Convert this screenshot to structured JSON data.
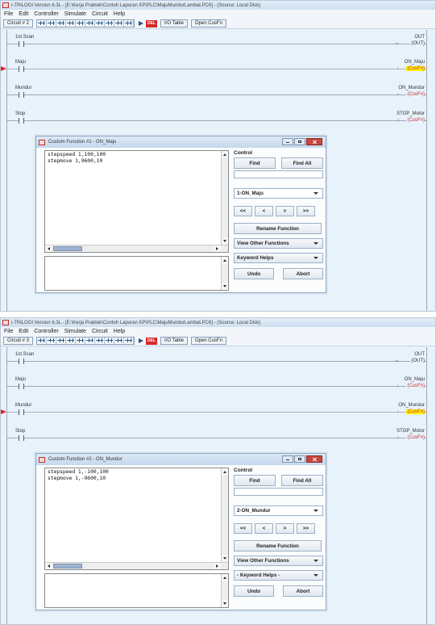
{
  "shots": [
    {
      "title": "i-TRiLOGI Version 6.3L - [E:\\Kerja Praktek\\Contoh Laporan KP\\PLC\\MajuMundurLambat.PC6] - (Source: Local Disk)",
      "menu": [
        "File",
        "Edit",
        "Controller",
        "Simulate",
        "Circuit",
        "Help"
      ],
      "circuit_label": "Circuit # 2",
      "del_label": "DEL",
      "io_table_label": "I/O Table",
      "open_cusfn_label": "Open CusFn",
      "rungs": [
        {
          "contact": "1st.Scan",
          "coil_name": "OUT",
          "coil_type": "(OUT)",
          "coil_num": "a1",
          "red": false,
          "highlight": false,
          "active": false
        },
        {
          "contact": "Maju",
          "coil_name": "ON_Maju",
          "coil_type": "(CusFn)",
          "coil_num": "1",
          "red": true,
          "highlight": true,
          "active": true
        },
        {
          "contact": "Mundur",
          "coil_name": "ON_Mundur",
          "coil_type": "(CusFn)",
          "coil_num": "2",
          "red": true,
          "highlight": false,
          "active": false
        },
        {
          "contact": "Stop",
          "coil_name": "STOP_Motor",
          "coil_type": "(CusFn)",
          "coil_num": "3",
          "red": true,
          "highlight": false,
          "active": false
        }
      ],
      "dialog": {
        "title": "Custom Function #1 - ON_Maju",
        "code": "stepspeed 1,100,100\nstepmove 1,9600,10",
        "control_label": "Control",
        "find": "Find",
        "find_all": "Find All",
        "function_select": "1-ON_Maju",
        "nav": [
          "<<",
          "<",
          ">",
          ">>"
        ],
        "rename": "Rename Function",
        "view_other": "View Other Functions",
        "keyword_helps": "Keyword Helps",
        "undo": "Undo",
        "abort": "Abort"
      }
    },
    {
      "title": "i-TRiLOGI Version 6.3L - [E:\\Kerja Praktek\\Contoh Laporan KP\\PLC\\MajuMundurLambat.PC6] - (Source: Local Disk)",
      "menu": [
        "File",
        "Edit",
        "Controller",
        "Simulate",
        "Circuit",
        "Help"
      ],
      "circuit_label": "Circuit # 3",
      "del_label": "DEL",
      "io_table_label": "I/O Table",
      "open_cusfn_label": "Open CusFn",
      "rungs": [
        {
          "contact": "1st.Scan",
          "coil_name": "OUT",
          "coil_type": "(OUT)",
          "coil_num": "a1",
          "red": false,
          "highlight": false,
          "active": false
        },
        {
          "contact": "Maju",
          "coil_name": "ON_Maju",
          "coil_type": "(CusFn)",
          "coil_num": "1",
          "red": true,
          "highlight": false,
          "active": false
        },
        {
          "contact": "Mundur",
          "coil_name": "ON_Mundur",
          "coil_type": "(CusFn)",
          "coil_num": "2",
          "red": true,
          "highlight": true,
          "active": true
        },
        {
          "contact": "Stop",
          "coil_name": "STOP_Motor",
          "coil_type": "(CusFn)",
          "coil_num": "3",
          "red": true,
          "highlight": false,
          "active": false
        }
      ],
      "dialog": {
        "title": "Custom Function #2 - ON_Mundur",
        "code": "stepspeed 1,-100,100\nstepmove 1,-9600,10",
        "control_label": "Control",
        "find": "Find",
        "find_all": "Find All",
        "function_select": "2-ON_Mundur",
        "nav": [
          "<<",
          "<",
          ">",
          ">>"
        ],
        "rename": "Rename Function",
        "view_other": "View Other Functions",
        "keyword_helps": "- Keyword Helps -",
        "undo": "Undo",
        "abort": "Abort"
      }
    }
  ]
}
